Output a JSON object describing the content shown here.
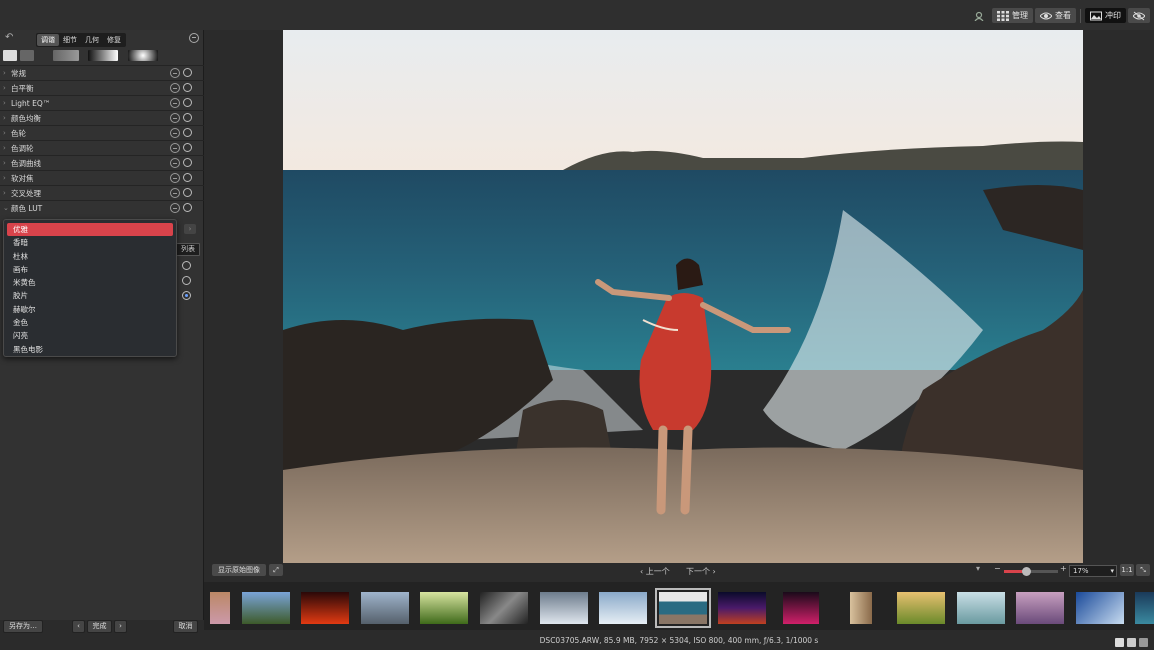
{
  "topbar": {
    "manage": "管理",
    "view": "查看",
    "print": "冲印"
  },
  "panel": {
    "tabs": [
      "调谐",
      "细节",
      "几何",
      "修复"
    ],
    "sections": [
      "常规",
      "白平衡",
      "Light EQ™",
      "颜色均衡",
      "色轮",
      "色调轮",
      "色调曲线",
      "软对焦",
      "交叉处理",
      "颜色 LUT"
    ]
  },
  "lut": {
    "list_button": "列表",
    "options": [
      "优雅",
      "香暗",
      "杜林",
      "画布",
      "米黄色",
      "胶片",
      "赫歇尔",
      "金色",
      "闪亮",
      "黑色电影"
    ],
    "selected": "优雅"
  },
  "bottom_left": {
    "save_as": "另存为…",
    "done": "完成",
    "cancel": "取消"
  },
  "viewer": {
    "show_original": "显示原始图像",
    "prev": "上一个",
    "next": "下一个",
    "zoom": "17%",
    "fit": "1:1"
  },
  "status": {
    "info": "DSC03705.ARW, 85.9 MB, 7952 × 5304, ISO 800, 400 mm, ƒ/6.3, 1/1000 s"
  },
  "thumbnails": [
    "sunset-coast",
    "red-sunset",
    "city-skyline",
    "forest-path",
    "architecture",
    "snow-mountain",
    "ski-lift",
    "beach-girl",
    "night-city",
    "neon-street",
    "doorway",
    "golden-field",
    "beach-hut",
    "pink-sky",
    "glass-building",
    "tower"
  ]
}
